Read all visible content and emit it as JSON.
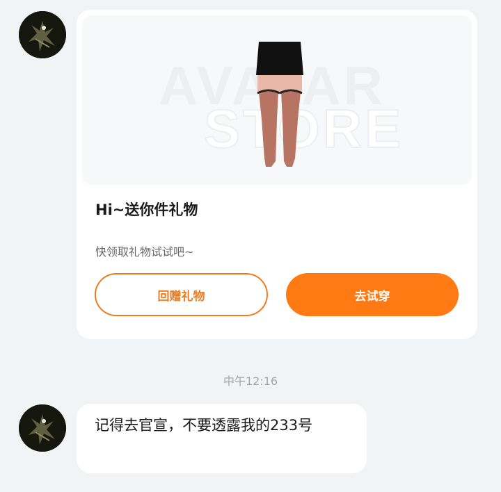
{
  "gift_card": {
    "watermark_line1": "AVATAR",
    "watermark_line2": "STORE",
    "title": "Hi~送你件礼物",
    "subtitle": "快领取礼物试试吧~",
    "return_gift_label": "回赠礼物",
    "try_on_label": "去试穿"
  },
  "timestamp": "中午12:16",
  "message": {
    "text": "记得去官宣，不要透露我的233号"
  },
  "colors": {
    "accent": "#ff7a12",
    "accent_border": "#f07a1f",
    "background": "#f2f3f5",
    "card": "#ffffff"
  },
  "icons": {
    "avatar": "user-avatar-photo"
  }
}
